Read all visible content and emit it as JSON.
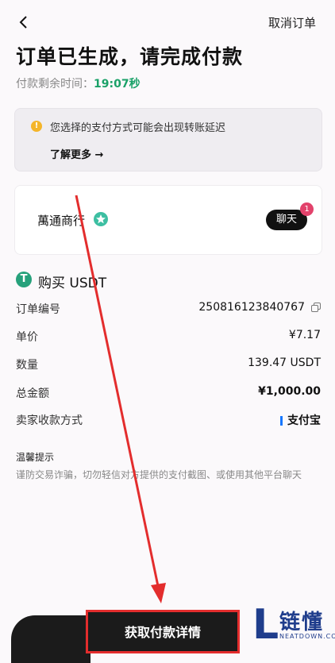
{
  "header": {
    "cancel_label": "取消订单",
    "title": "订单已生成，请完成付款",
    "timer_label": "付款剩余时间：",
    "timer_value": "19:07秒"
  },
  "notice": {
    "message": "您选择的支付方式可能会出现转账延迟",
    "learn_more": "了解更多 →"
  },
  "seller": {
    "name": "萬通商行",
    "chat_label": "聊天",
    "unread_count": "1"
  },
  "order": {
    "heading": "购买 USDT",
    "rows": [
      {
        "key": "订单编号",
        "value": "250816123840767"
      },
      {
        "key": "单价",
        "value": "¥7.17"
      },
      {
        "key": "数量",
        "value": "139.47 USDT"
      },
      {
        "key": "总金额",
        "value": "¥1,000.00"
      },
      {
        "key": "卖家收款方式",
        "value": "支付宝"
      }
    ]
  },
  "tips": {
    "heading": "温馨提示",
    "body": "谨防交易诈骗，切勿轻信对方提供的支付截图、或使用其他平台聊天"
  },
  "cta": {
    "label": "获取付款详情"
  },
  "watermark": {
    "logo_letter": "L",
    "name": "链懂",
    "site": "NEATDOWN.COM"
  },
  "colors": {
    "accent_green": "#1aa168",
    "tether_green": "#26a17b",
    "highlight_red": "#e32d2d",
    "badge_pink": "#e2426b"
  }
}
